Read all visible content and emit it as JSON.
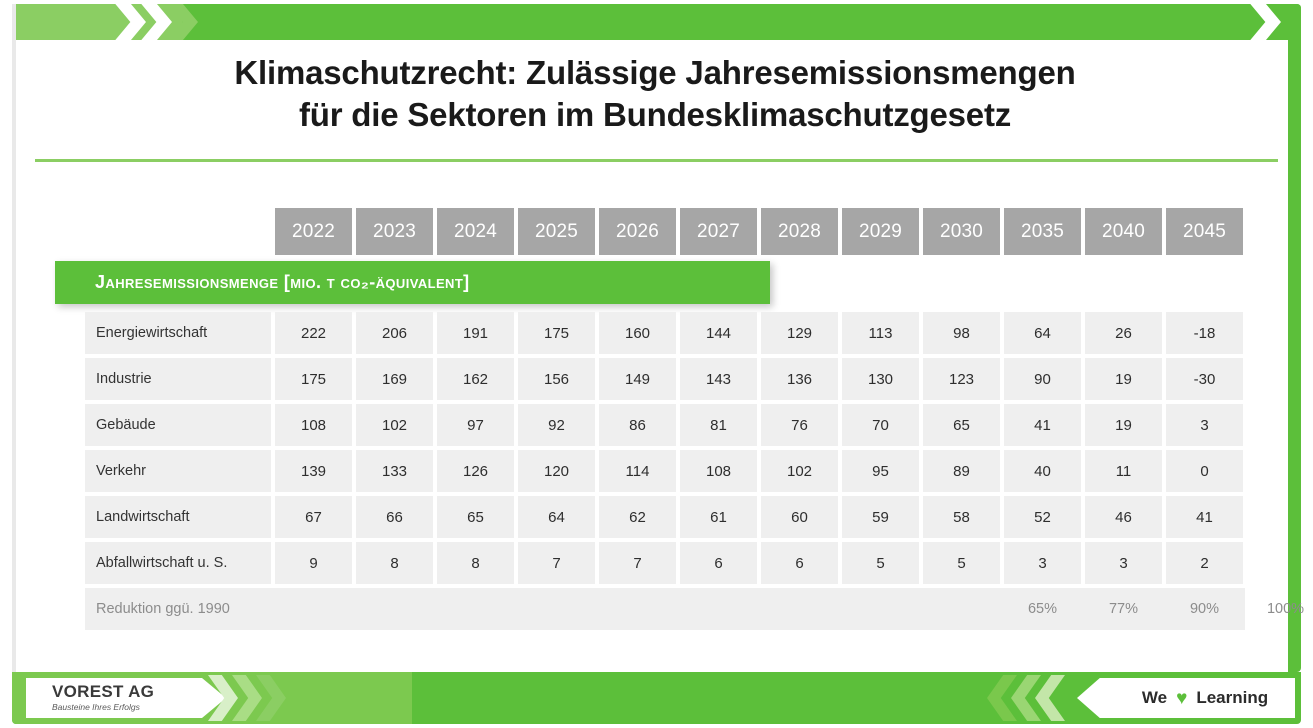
{
  "title": {
    "line1": "Klimaschutzrecht: Zulässige Jahresemissionsmengen",
    "line2": "für die Sektoren im Bundesklimaschutzgesetz"
  },
  "banner": {
    "label": "Jahresemissionsmenge [Mio. t CO₂-Äquivalent]"
  },
  "footer": {
    "logo_name": "VOREST AG",
    "logo_tagline": "Bausteine Ihres Erfolgs",
    "we": "We",
    "heart": "♥",
    "learning": "Learning"
  },
  "colors": {
    "green_primary": "#5cbf3a",
    "green_light": "#8bce63",
    "header_gray": "#a6a6a6",
    "cell_gray": "#efefef",
    "text_dark": "#2e2e2e",
    "text_muted": "#8c8c8c"
  },
  "chart_data": {
    "type": "table",
    "title": "Klimaschutzrecht: Zulässige Jahresemissionsmengen für die Sektoren im Bundesklimaschutzgesetz",
    "subtitle": "Jahresemissionsmenge [Mio. t CO₂-Äquivalent]",
    "columns": [
      "2022",
      "2023",
      "2024",
      "2025",
      "2026",
      "2027",
      "2028",
      "2029",
      "2030",
      "2035",
      "2040",
      "2045"
    ],
    "row_header": "",
    "rows": [
      {
        "label": "Energiewirtschaft",
        "values": [
          "222",
          "206",
          "191",
          "175",
          "160",
          "144",
          "129",
          "113",
          "98",
          "64",
          "26",
          "-18"
        ]
      },
      {
        "label": "Industrie",
        "values": [
          "175",
          "169",
          "162",
          "156",
          "149",
          "143",
          "136",
          "130",
          "123",
          "90",
          "19",
          "-30"
        ]
      },
      {
        "label": "Gebäude",
        "values": [
          "108",
          "102",
          "97",
          "92",
          "86",
          "81",
          "76",
          "70",
          "65",
          "41",
          "19",
          "3"
        ]
      },
      {
        "label": "Verkehr",
        "values": [
          "139",
          "133",
          "126",
          "120",
          "114",
          "108",
          "102",
          "95",
          "89",
          "40",
          "11",
          "0"
        ]
      },
      {
        "label": "Landwirtschaft",
        "values": [
          "67",
          "66",
          "65",
          "64",
          "62",
          "61",
          "60",
          "59",
          "58",
          "52",
          "46",
          "41"
        ]
      },
      {
        "label": "Abfallwirtschaft u. S.",
        "values": [
          "9",
          "8",
          "8",
          "7",
          "7",
          "6",
          "6",
          "5",
          "5",
          "3",
          "3",
          "2"
        ]
      }
    ],
    "footer_row": {
      "label": "Reduktion ggü. 1990",
      "values": [
        "",
        "",
        "",
        "",
        "",
        "",
        "",
        "",
        "65%",
        "77%",
        "90%",
        "100%"
      ]
    }
  }
}
